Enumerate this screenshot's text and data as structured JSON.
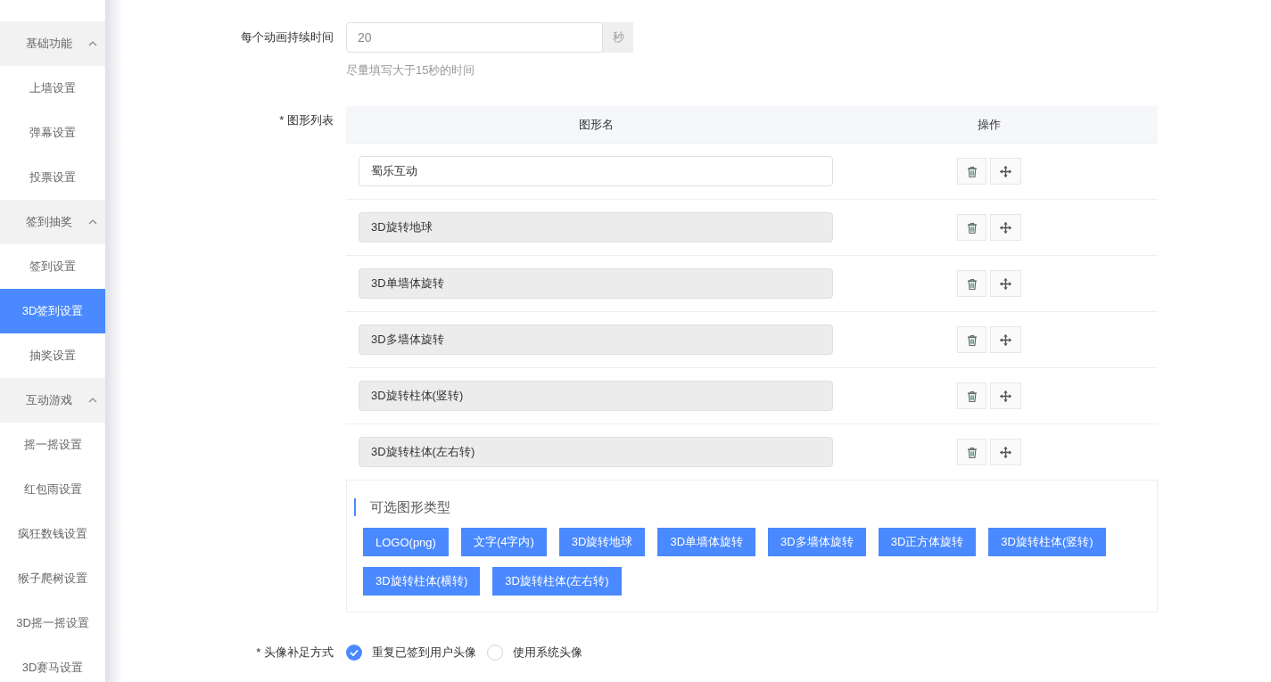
{
  "sidebar": {
    "groups": [
      {
        "label": "基础功能",
        "expanded": true,
        "items": [
          {
            "label": "上墙设置",
            "selected": false
          },
          {
            "label": "弹幕设置",
            "selected": false
          },
          {
            "label": "投票设置",
            "selected": false
          }
        ]
      },
      {
        "label": "签到抽奖",
        "expanded": true,
        "items": [
          {
            "label": "签到设置",
            "selected": false
          },
          {
            "label": "3D签到设置",
            "selected": true
          },
          {
            "label": "抽奖设置",
            "selected": false
          }
        ]
      },
      {
        "label": "互动游戏",
        "expanded": true,
        "items": [
          {
            "label": "摇一摇设置",
            "selected": false
          },
          {
            "label": "红包雨设置",
            "selected": false
          },
          {
            "label": "疯狂数钱设置",
            "selected": false
          },
          {
            "label": "猴子爬树设置",
            "selected": false
          },
          {
            "label": "3D摇一摇设置",
            "selected": false
          },
          {
            "label": "3D赛马设置",
            "selected": false
          }
        ]
      }
    ]
  },
  "form": {
    "duration": {
      "label": "每个动画持续时间",
      "value": "20",
      "unit": "秒",
      "hint": "尽量填写大于15秒的时间"
    },
    "shapes": {
      "label": "* 图形列表",
      "columns": [
        "图形名",
        "操作"
      ],
      "rows": [
        {
          "name": "蜀乐互动",
          "disabled": false
        },
        {
          "name": "3D旋转地球",
          "disabled": true
        },
        {
          "name": "3D单墙体旋转",
          "disabled": true
        },
        {
          "name": "3D多墙体旋转",
          "disabled": true
        },
        {
          "name": "3D旋转柱体(竖转)",
          "disabled": true
        },
        {
          "name": "3D旋转柱体(左右转)",
          "disabled": true
        }
      ]
    },
    "shape_types": {
      "title": "可选图形类型",
      "options": [
        "LOGO(png)",
        "文字(4字内)",
        "3D旋转地球",
        "3D单墙体旋转",
        "3D多墙体旋转",
        "3D正方体旋转",
        "3D旋转柱体(竖转)",
        "3D旋转柱体(横转)",
        "3D旋转柱体(左右转)"
      ]
    },
    "avatar_fill": {
      "label": "* 头像补足方式",
      "options": [
        {
          "label": "重复已签到用户头像",
          "selected": true
        },
        {
          "label": "使用系统头像",
          "selected": false
        }
      ]
    }
  }
}
